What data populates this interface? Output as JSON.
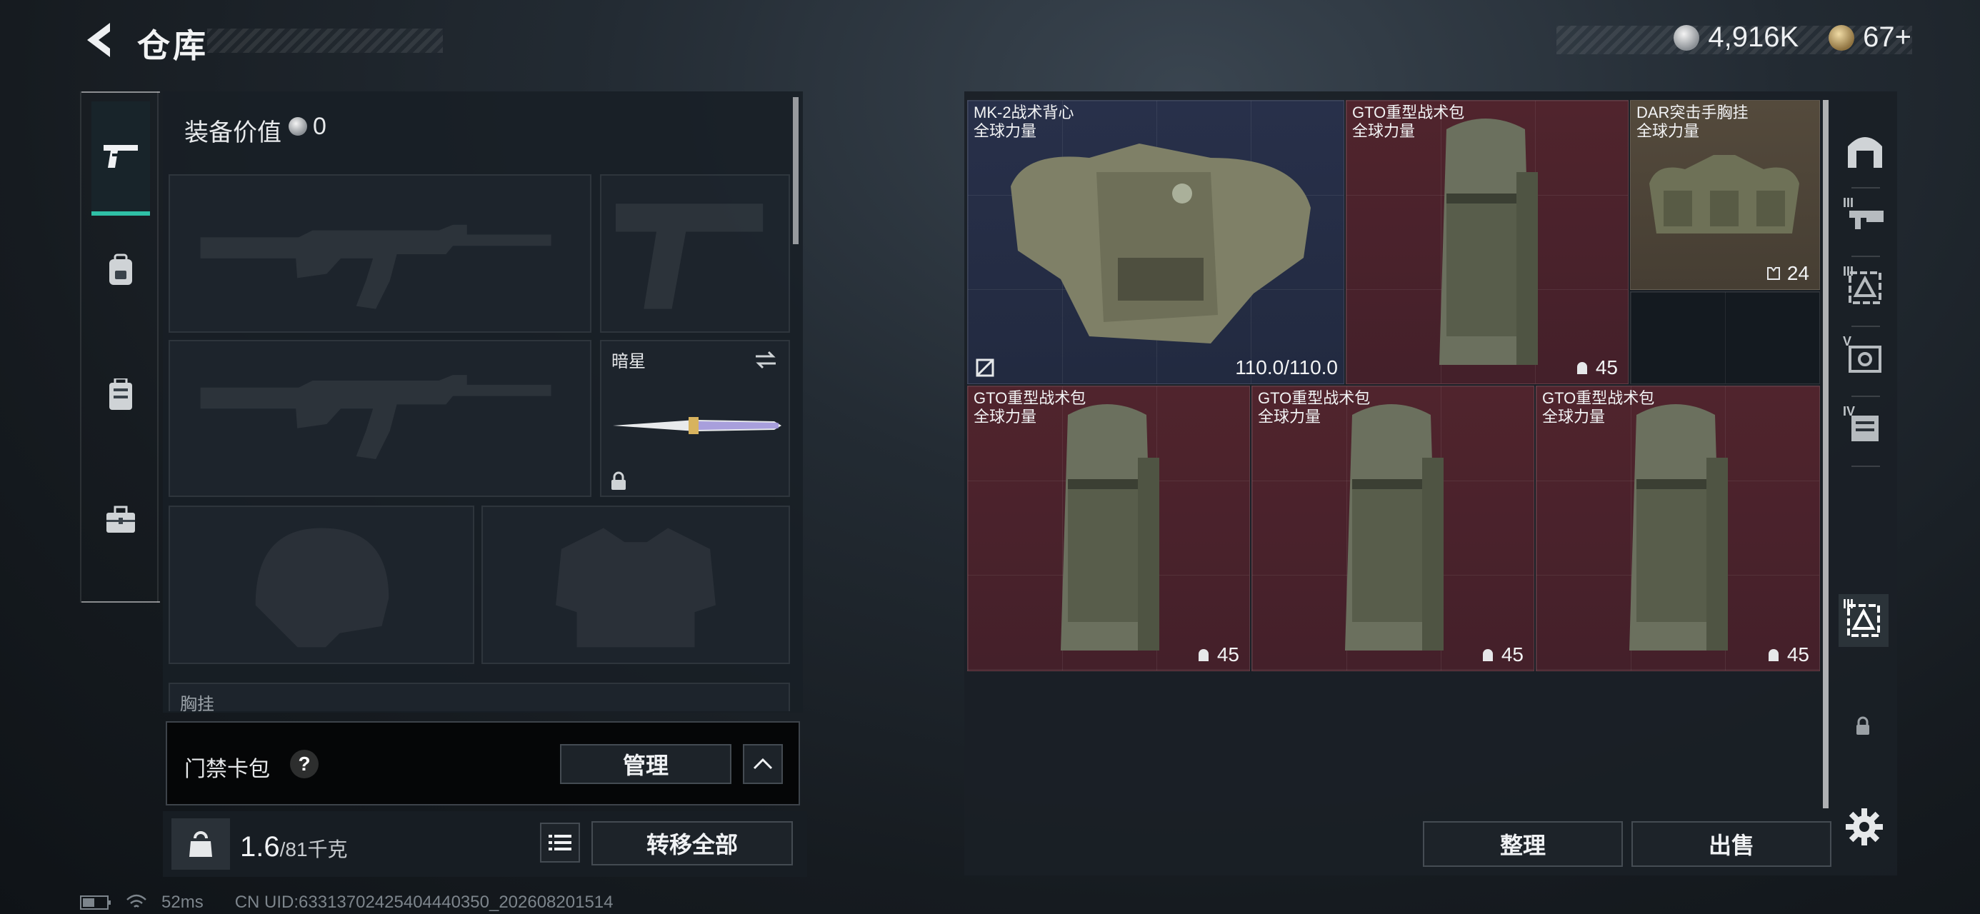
{
  "header": {
    "title": "仓库",
    "currencies": [
      {
        "icon": "silver-coin-icon",
        "value": "4,916K"
      },
      {
        "icon": "gold-coin-icon",
        "value": "67+"
      }
    ]
  },
  "left_tabs": [
    "weapon-tab",
    "backpack-tab",
    "vest-tab",
    "toolbox-tab"
  ],
  "loadout": {
    "equip_value_label": "装备价值",
    "equip_value": "0",
    "melee_slot_name": "暗星",
    "chest_rig_label": "胸挂"
  },
  "keycard": {
    "label": "门禁卡包",
    "help": "?",
    "manage_label": "管理"
  },
  "weight": {
    "current": "1.6",
    "max_unit": "/81千克",
    "kg_label": "KG",
    "transfer_label": "转移全部"
  },
  "storage": {
    "items": [
      {
        "name": "MK-2战术背心",
        "sub": "全球力量",
        "durability": "110.0/110.0"
      },
      {
        "name": "GTO重型战术包",
        "sub": "全球力量",
        "count": "45"
      },
      {
        "name": "DAR突击手胸挂",
        "sub": "全球力量",
        "count": "24"
      },
      {
        "name": "GTO重型战术包",
        "sub": "全球力量",
        "count": "45"
      },
      {
        "name": "GTO重型战术包",
        "sub": "全球力量",
        "count": "45"
      },
      {
        "name": "GTO重型战术包",
        "sub": "全球力量",
        "count": "45"
      }
    ],
    "sort_label": "整理",
    "sell_label": "出售"
  },
  "side_tabs": [
    "",
    "III",
    "III",
    "V",
    "IV",
    "III"
  ],
  "status": {
    "ping": "52ms",
    "uid": "CN UID:63313702425404440350_202608201514"
  },
  "colors": {
    "accent": "#2fc0a6",
    "item_red": "#4a222b",
    "item_blue": "#262e46",
    "item_tan": "#4e4538"
  }
}
